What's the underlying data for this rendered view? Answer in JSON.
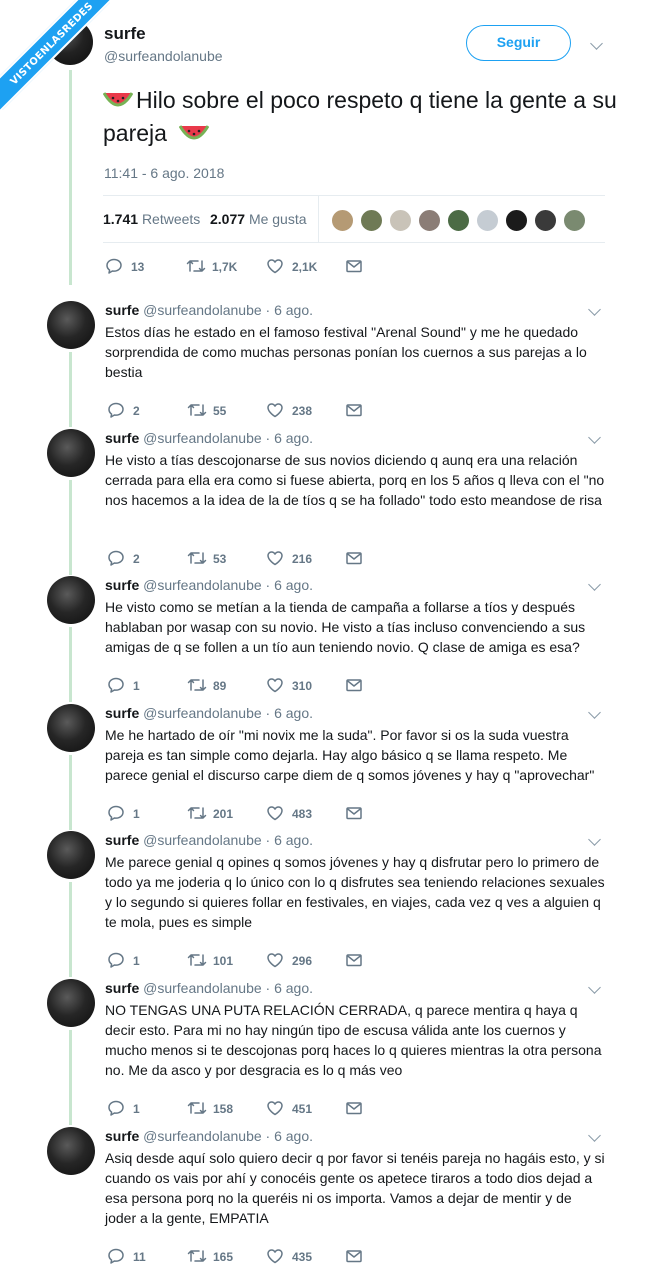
{
  "watermark": "VISTOENLASREDES",
  "main_tweet": {
    "name": "surfe",
    "handle": "@surfeandolanube",
    "follow_label": "Seguir",
    "text": "Hilo sobre el poco respeto q tiene la gente a su pareja",
    "emoji": "watermelon-icon",
    "time": "11:41 - 6 ago. 2018",
    "retweets_count": "1.741",
    "retweets_label": "Retweets",
    "likes_count": "2.077",
    "likes_label": "Me gusta",
    "actions": {
      "replies": "13",
      "retweets": "1,7K",
      "likes": "2,1K"
    }
  },
  "replies": [
    {
      "name": "surfe",
      "meta": "@surfeandolanube · 6 ago.",
      "text": "Estos días he estado en el famoso festival \"Arenal Sound\" y me he quedado sorprendida de como muchas personas ponían los cuernos a sus parejas a lo bestia",
      "replies": "2",
      "retweets": "55",
      "likes": "238"
    },
    {
      "name": "surfe",
      "meta": "@surfeandolanube · 6 ago.",
      "text": "He visto a tías descojonarse de sus novios diciendo q aunq era una relación cerrada para ella era como si fuese abierta, porq en los 5 años q lleva con el \"no nos hacemos a la idea de la de tíos q se ha follado\" todo esto meandose de risa",
      "replies": "2",
      "retweets": "53",
      "likes": "216"
    },
    {
      "name": "surfe",
      "meta": "@surfeandolanube · 6 ago.",
      "text": "He visto como se metían a la tienda de campaña a follarse a tíos y después hablaban por wasap con su novio. He visto a tías incluso convenciendo a sus amigas de q se follen a un tío aun teniendo novio. Q clase de amiga es esa?",
      "replies": "1",
      "retweets": "89",
      "likes": "310"
    },
    {
      "name": "surfe",
      "meta": "@surfeandolanube · 6 ago.",
      "text": "Me he hartado de oír \"mi novix me la suda\". Por favor si os la suda vuestra pareja es tan simple como dejarla. Hay algo básico q se llama respeto. Me parece genial el discurso carpe diem de q somos jóvenes y hay q \"aprovechar\"",
      "replies": "1",
      "retweets": "201",
      "likes": "483"
    },
    {
      "name": "surfe",
      "meta": "@surfeandolanube · 6 ago.",
      "text": "Me parece genial q opines q somos jóvenes y hay q disfrutar pero lo primero de todo ya me joderia q lo único con lo q disfrutes sea teniendo relaciones sexuales y lo segundo si quieres follar en festivales, en viajes, cada vez q ves a alguien q te mola, pues es simple",
      "replies": "1",
      "retweets": "101",
      "likes": "296"
    },
    {
      "name": "surfe",
      "meta": "@surfeandolanube · 6 ago.",
      "text": "NO TENGAS UNA PUTA RELACIÓN CERRADA, q parece mentira q haya q decir esto. Para mi no hay ningún tipo de escusa válida ante los cuernos y mucho menos si te descojonas porq haces lo q quieres mientras la otra persona no. Me da asco y por desgracia es lo q más veo",
      "replies": "1",
      "retweets": "158",
      "likes": "451"
    },
    {
      "name": "surfe",
      "meta": "@surfeandolanube · 6 ago.",
      "text": "Asiq desde aquí solo quiero decir q por favor si tenéis pareja no hagáis esto, y si cuando os vais por ahí y conocéis gente os apetece tiraros a todo dios dejad a esa persona porq no la queréis ni os importa. Vamos a dejar de mentir y de joder a la gente, EMPATIA",
      "replies": "11",
      "retweets": "165",
      "likes": "435"
    }
  ],
  "colors": {
    "accent": "#1da1f2",
    "thread_line": "#c8e6cf",
    "muted": "#657786",
    "text": "#14171a"
  }
}
